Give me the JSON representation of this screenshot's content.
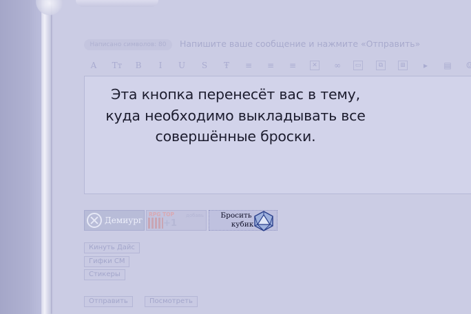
{
  "editor": {
    "char_count_label": "Написано символов: 80",
    "hint": "Напишите ваше сообщение и нажмите «Отправить»"
  },
  "toolbar": {
    "buttons": [
      {
        "name": "font-color-icon",
        "glyph": "A"
      },
      {
        "name": "font-size-icon",
        "glyph": "Tт"
      },
      {
        "name": "bold-icon",
        "glyph": "B"
      },
      {
        "name": "italic-icon",
        "glyph": "I"
      },
      {
        "name": "underline-icon",
        "glyph": "U"
      },
      {
        "name": "strikethrough-icon",
        "glyph": "S"
      },
      {
        "name": "text-format-icon",
        "glyph": "Ŧ"
      },
      {
        "name": "align-left-icon",
        "glyph": "≡"
      },
      {
        "name": "align-center-icon",
        "glyph": "≡"
      },
      {
        "name": "align-right-icon",
        "glyph": "≡"
      },
      {
        "name": "image-icon",
        "glyph": "✕"
      },
      {
        "name": "link-icon",
        "glyph": "∞"
      },
      {
        "name": "quote-icon",
        "glyph": "▭"
      },
      {
        "name": "copy-icon",
        "glyph": "⧉"
      },
      {
        "name": "table-icon",
        "glyph": "⊞"
      },
      {
        "name": "play-icon",
        "glyph": "▸"
      },
      {
        "name": "lock-icon",
        "glyph": "▤"
      },
      {
        "name": "smile-icon",
        "glyph": "☺"
      }
    ]
  },
  "callout": {
    "line1": "Эта кнопка перенесёт вас в тему,",
    "line2": "куда необходимо выкладывать все",
    "line3": "совершённые броски."
  },
  "banners": {
    "demiurg": "Демиург",
    "rpg_top": "RPG TOP",
    "rpg_add": "добавь",
    "rpg_votes": "+1 голос",
    "dice_line1": "Бросить",
    "dice_line2": "кубик"
  },
  "buttons": {
    "roll_dice": "Кинуть Дайс",
    "gifs": "Гифки СМ",
    "stickers": "Стикеры",
    "send": "Отправить",
    "preview": "Посмотреть"
  }
}
